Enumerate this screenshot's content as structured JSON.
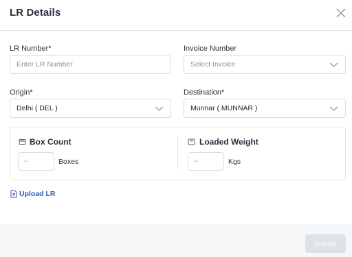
{
  "modal": {
    "title": "LR Details",
    "close_icon": "close-icon"
  },
  "form": {
    "lr_number": {
      "label": "LR Number*",
      "placeholder": "Enter LR Number",
      "value": ""
    },
    "invoice_number": {
      "label": "Invoice Number",
      "placeholder": "Select Invoice",
      "value": ""
    },
    "origin": {
      "label": "Origin*",
      "value": "Delhi ( DEL )"
    },
    "destination": {
      "label": "Destination*",
      "value": "Munnar ( MUNNAR )"
    }
  },
  "box_count": {
    "icon": "box-icon",
    "title": "Box Count",
    "value": "--",
    "unit": "Boxes"
  },
  "loaded_weight": {
    "icon": "weight-icon",
    "title": "Loaded Weight",
    "value": "--",
    "unit": "Kgs"
  },
  "upload": {
    "icon": "upload-file-icon",
    "label": "Upload LR"
  },
  "footer": {
    "submit_label": "Submit"
  }
}
